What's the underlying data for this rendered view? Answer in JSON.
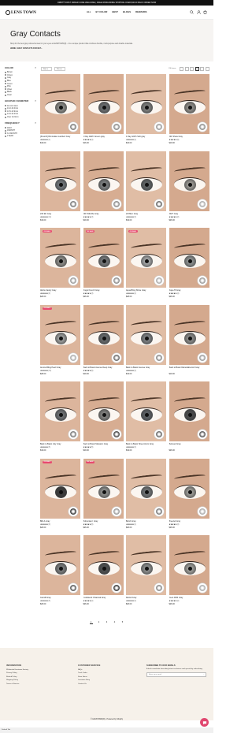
{
  "announcement": "ORBIT® FIRST ORDER CODE WELCOME | FREE WORLDWIDE SHIPPING OVER $40.00 BACK ORDER NOW",
  "header": {
    "logo": "LENS TOWN",
    "nav": [
      "ALL",
      "BY COLOR",
      "BEST",
      "BLOGS",
      "REWARDS"
    ],
    "icons": [
      "search-icon",
      "account-icon",
      "cart-icon"
    ]
  },
  "hero": {
    "title": "Gray Contacts",
    "description": "Shop for the best gray colored lenses for your eyes at LENSTOWN(R) - it is a unique product that combines flexible, multi-purpose and durable materials.",
    "breadcrumb": "HOME / GRAY CONTACTS FOR NET..."
  },
  "filters": {
    "color": {
      "title": "COLOR",
      "options": [
        "Brown",
        "Choco",
        "Gray",
        "Blue",
        "Green",
        "Pink",
        "Violet",
        "Black",
        "Clear"
      ]
    },
    "diameter": {
      "title": "GRAPHIC DIAMETER",
      "options": [
        "11.0-13.1mm",
        "13.2-13.4mm",
        "13.5-13.9mm",
        "14.0-14.2mm",
        "Over 14.3mm"
      ]
    },
    "frequency": {
      "title": "FREQUENCY",
      "options": [
        "1DAY",
        "1MONTH",
        "3-6 MONTH",
        "1YEAR"
      ]
    }
  },
  "toolbar": {
    "sort": "Sort",
    "price": "Price",
    "count": "196 items"
  },
  "products": [
    {
      "name": "[3month] Rimmaltex Lambert Gray",
      "rating": "★★★★★",
      "reviews": "(2)",
      "price": "$19.00",
      "badge": "",
      "iris": "#8a8a86",
      "lens": "#7a7a78"
    },
    {
      "name": "1 Day Glitt'h Greem gray",
      "rating": "★★★★★",
      "reviews": "(4)",
      "price": "$16.00",
      "badge": "",
      "iris": "#6b6e70",
      "lens": "#888"
    },
    {
      "name": "1 Day Glitt'h Soft gray",
      "rating": "★★★★★",
      "reviews": "(4)",
      "price": "$16.00",
      "badge": "",
      "iris": "#7e7f7d",
      "lens": "#999"
    },
    {
      "name": "24F Shaw Gray",
      "rating": "★★★★★",
      "reviews": "(9)",
      "price": "$19.00",
      "badge": "",
      "iris": "#8f8d88",
      "lens": "#8c8c8a"
    },
    {
      "name": "24F Eh Gray",
      "rating": "★★★★★",
      "reviews": "(14)",
      "price": "$19.00",
      "badge": "",
      "iris": "#6f7478",
      "lens": "#777"
    },
    {
      "name": "24F Wilk Me Gray",
      "rating": "★★★★★",
      "reviews": "(3)",
      "price": "$19.00",
      "badge": "",
      "iris": "#7c7f80",
      "lens": "#888"
    },
    {
      "name": "24f Mon Gray",
      "rating": "★★★★★",
      "reviews": "(3)",
      "price": "$19.00",
      "badge": "",
      "iris": "#5f6364",
      "lens": "#666"
    },
    {
      "name": "3027 Gray",
      "rating": "★★★★★",
      "reviews": "(2)",
      "price": "$26.00",
      "badge": "",
      "iris": "#9a9792",
      "lens": "#aaa"
    },
    {
      "name": "Aloha Candy Gray",
      "rating": "★★★★★",
      "reviews": "(9)",
      "price": "$26.00",
      "badge": "ON SALE",
      "iris": "#8b8a86",
      "lens": "#999"
    },
    {
      "name": "Angel French Gray",
      "rating": "★★★★★",
      "reviews": "(3)",
      "price": "$26.00",
      "badge": "ON SALE",
      "iris": "#75787a",
      "lens": "#888"
    },
    {
      "name": "Aqua Bling Shine Gray",
      "rating": "★★★★★",
      "reviews": "(2)",
      "price": "$28.00",
      "badge": "ON SALE",
      "iris": "#a3a5a6",
      "lens": "#aaa"
    },
    {
      "name": "Aqua Hi Gray",
      "rating": "★★★★★",
      "reviews": "(4)",
      "price": "$26.00",
      "badge": "",
      "iris": "#8c8f8f",
      "lens": "#999"
    },
    {
      "name": "Aurora Bling Pearl Gray",
      "rating": "★★★★★",
      "reviews": "(13)",
      "price": "$28.00",
      "badge": "ON SALE",
      "iris": "#9c9e9d",
      "lens": "#aaa"
    },
    {
      "name": "Back to Basic Avenue Deep Gray",
      "rating": "★★★★★",
      "reviews": "(6)",
      "price": "$19.00",
      "badge": "",
      "iris": "#666a6c",
      "lens": "#666"
    },
    {
      "name": "Back to Basic Avenue Gray",
      "rating": "★★★★★",
      "reviews": "(3)",
      "price": "$19.00",
      "badge": "",
      "iris": "#7d8083",
      "lens": "#888"
    },
    {
      "name": "Back to Basic Dalnebaba Ash Gray",
      "rating": "",
      "reviews": "",
      "price": "$19.00",
      "badge": "",
      "iris": "#8a8a88",
      "lens": "#999"
    },
    {
      "name": "Back to Basic July Gray",
      "rating": "★★★★★",
      "reviews": "(5)",
      "price": "$19.00",
      "badge": "",
      "iris": "#6e7072",
      "lens": "#777"
    },
    {
      "name": "Back to Basic Macaron Gray",
      "rating": "★★★★★",
      "reviews": "(5)",
      "price": "$19.00",
      "badge": "",
      "iris": "#80807e",
      "lens": "#444"
    },
    {
      "name": "Back to Basic Street Arum Gray",
      "rating": "★★★★★",
      "reviews": "(3)",
      "price": "$19.00",
      "badge": "",
      "iris": "#5c6064",
      "lens": "#666"
    },
    {
      "name": "Beloved Gray",
      "rating": "",
      "reviews": "",
      "price": "$26.00",
      "badge": "",
      "iris": "#4b4b4b",
      "lens": "#555"
    },
    {
      "name": "Billi-A Gray",
      "rating": "★★★★★",
      "reviews": "(9)",
      "price": "$26.00",
      "badge": "ON SALE",
      "iris": "#3a3a3a",
      "lens": "#333"
    },
    {
      "name": "Bohemian I Gray",
      "rating": "★★★★★",
      "reviews": "(6)",
      "price": "$26.00",
      "badge": "ON SALE",
      "iris": "#8d8e8c",
      "lens": "#999"
    },
    {
      "name": "Bomb Gray",
      "rating": "★★★★★",
      "reviews": "(1)",
      "price": "$26.00",
      "badge": "",
      "iris": "#6f7274",
      "lens": "#777"
    },
    {
      "name": "Breezel Gray",
      "rating": "★★★★★",
      "reviews": "(4)",
      "price": "$26.00",
      "badge": "",
      "iris": "#9a9994",
      "lens": "#aaa"
    },
    {
      "name": "Camilli Gray",
      "rating": "★★★★★",
      "reviews": "(5)",
      "price": "$26.00",
      "badge": "",
      "iris": "#7a7c7c",
      "lens": "#555"
    },
    {
      "name": "Cookisen2 Charcoal Gray",
      "rating": "★★★★★",
      "reviews": "(2)",
      "price": "$26.00",
      "badge": "",
      "iris": "#4d4f50",
      "lens": "#333"
    },
    {
      "name": "Daris2 Gray",
      "rating": "★★★★★",
      "reviews": "(3)",
      "price": "$26.00",
      "badge": "",
      "iris": "#8b8d8c",
      "lens": "#888"
    },
    {
      "name": "Dear 4000 Gray",
      "rating": "★★★★★",
      "reviews": "(2)",
      "price": "$26.00",
      "badge": "",
      "iris": "#9e9d98",
      "lens": "#aaa"
    }
  ],
  "pager": [
    "1",
    "2",
    "3",
    "4",
    "5"
  ],
  "footer": {
    "col1": {
      "title": "INFORMATION",
      "links": [
        "Wholesale/Lenstown Society",
        "Privacy Policy",
        "Refund Policy",
        "Shipping Policy",
        "Terms of Service"
      ]
    },
    "col2": {
      "title": "CUSTOMER SERVICE",
      "links": [
        "FAQs",
        "Track Order",
        "Store Hours",
        "Lenstown Story",
        "Contact Us"
      ]
    },
    "newsletter": {
      "title": "SUBSCRIBE TO OUR EMAILS",
      "text": "A fresh newsletter describing latest exclusives and special by subscribing.",
      "placeholder": "Enter your email",
      "arrow": "→"
    },
    "copyright": "© LENSTOWN(R) - Powered by Shopify"
  },
  "status": "Default Tab"
}
